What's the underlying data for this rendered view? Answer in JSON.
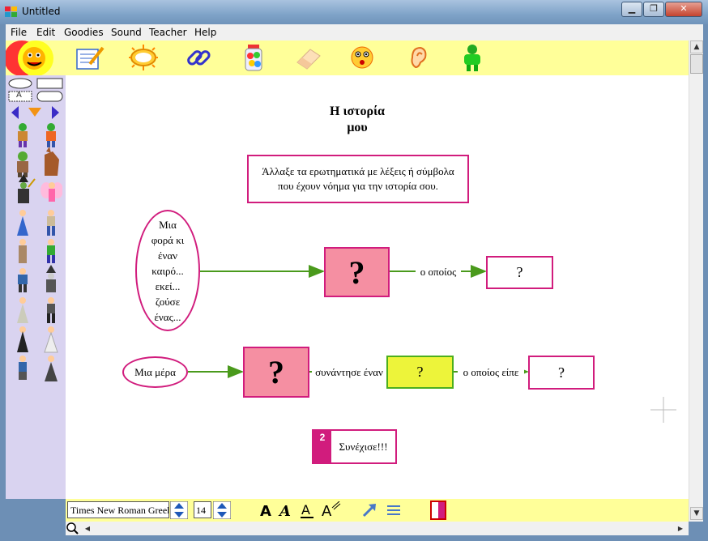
{
  "window": {
    "title": "Untitled",
    "minimize": "▁",
    "restore": "❐",
    "close": "✕"
  },
  "menu": [
    "File",
    "Edit",
    "Goodies",
    "Sound",
    "Teacher",
    "Help"
  ],
  "toolbar_icons": [
    "notepad-icon",
    "sun-oval-icon",
    "chain-link-icon",
    "jar-icon",
    "eraser-icon",
    "face-icon",
    "ear-icon",
    "person-icon"
  ],
  "palette": {
    "shape_a_label": "A"
  },
  "canvas": {
    "title_line1": "Η ιστορία",
    "title_line2": "μου",
    "instruction": "Άλλαξε τα ερωτηματικά με λέξεις ή σύμβολα που έχουν νόημα για την ιστορία σου.",
    "start_oval": "Μια φορά κι έναν καιρό... εκεί... ζούσε ένας...",
    "q1": "?",
    "link1": "ο οποίος",
    "q2": "?",
    "oval2": "Μια μέρα",
    "q3": "?",
    "link2": "συνάντησε έναν",
    "q4": "?",
    "link3": "ο οποίος είπε",
    "q5": "?",
    "continue_number": "2",
    "continue_label": "Συνέχισε!!!"
  },
  "bottombar": {
    "font_name": "Times New Roman Greek",
    "font_size": "14"
  },
  "colors": {
    "pink": "#f58fa2",
    "magenta": "#d11c7d",
    "lime": "#edf43a",
    "green_border": "#4caf1c",
    "arrow": "#4a9a1c",
    "toolbar_bg": "#ffff99",
    "palette_bg": "#d9d3f0"
  }
}
